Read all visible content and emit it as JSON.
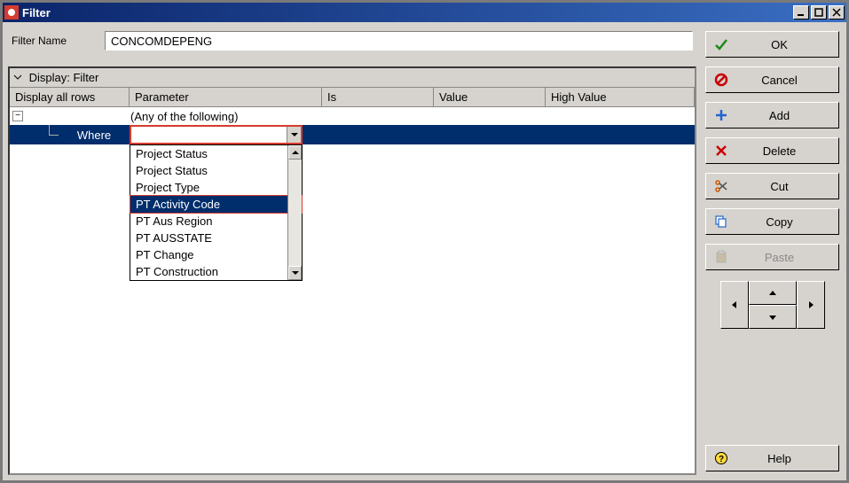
{
  "window": {
    "title": "Filter"
  },
  "filter_name": {
    "label": "Filter Name",
    "value": "CONCOMDEPENG"
  },
  "section": {
    "title": "Display: Filter"
  },
  "columns": {
    "display": "Display all rows",
    "parameter": "Parameter",
    "is": "Is",
    "value": "Value",
    "high_value": "High Value"
  },
  "tree": {
    "group_label": "(Any of the following)",
    "where_label": "Where",
    "param_value": ""
  },
  "dropdown": {
    "items": [
      "Project Status",
      "Project Status",
      "Project Type",
      "PT Activity Code",
      "PT Aus Region",
      "PT AUSSTATE",
      "PT Change",
      "PT Construction"
    ],
    "selected_index": 3
  },
  "buttons": {
    "ok": "OK",
    "cancel": "Cancel",
    "add": "Add",
    "delete": "Delete",
    "cut": "Cut",
    "copy": "Copy",
    "paste": "Paste",
    "help": "Help"
  }
}
